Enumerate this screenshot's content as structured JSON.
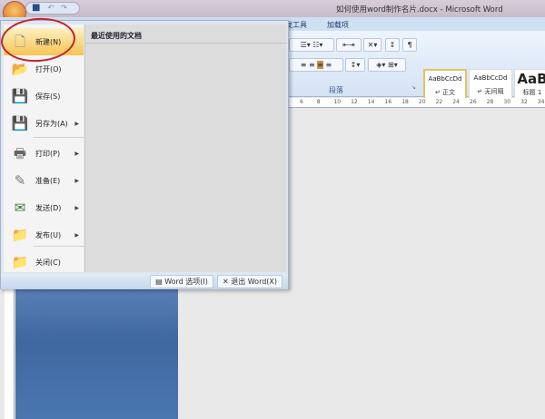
{
  "window": {
    "title": "如何使用word制作名片.docx - Microsoft Word"
  },
  "tabs": [
    "发工具",
    "加载项"
  ],
  "ribbon": {
    "paragraph_group": "段落",
    "styles": [
      {
        "preview": "AaBbCcDd",
        "name": "↵ 正文"
      },
      {
        "preview": "AaBbCcDd",
        "name": "↵ 无间隔"
      },
      {
        "preview": "AaB",
        "name": "标题 1"
      }
    ]
  },
  "ruler": [
    "6",
    "8",
    "10",
    "12",
    "14",
    "16",
    "18",
    "20",
    "22",
    "24",
    "26",
    "28",
    "30",
    "32",
    "34"
  ],
  "office_menu": {
    "items": [
      {
        "label": "新建(N)",
        "icon": "new-document-icon",
        "submenu": false
      },
      {
        "label": "打开(O)",
        "icon": "open-folder-icon",
        "submenu": false
      },
      {
        "label": "保存(S)",
        "icon": "save-icon",
        "submenu": false
      },
      {
        "label": "另存为(A)",
        "icon": "save-as-icon",
        "submenu": true
      },
      {
        "label": "打印(P)",
        "icon": "print-icon",
        "submenu": true
      },
      {
        "label": "准备(E)",
        "icon": "prepare-icon",
        "submenu": true
      },
      {
        "label": "发送(D)",
        "icon": "send-icon",
        "submenu": true
      },
      {
        "label": "发布(U)",
        "icon": "publish-icon",
        "submenu": true
      },
      {
        "label": "关闭(C)",
        "icon": "close-folder-icon",
        "submenu": false
      }
    ],
    "recent_title": "最近使用的文档",
    "options_button": "Word 选项(I)",
    "exit_button": "退出 Word(X)"
  }
}
